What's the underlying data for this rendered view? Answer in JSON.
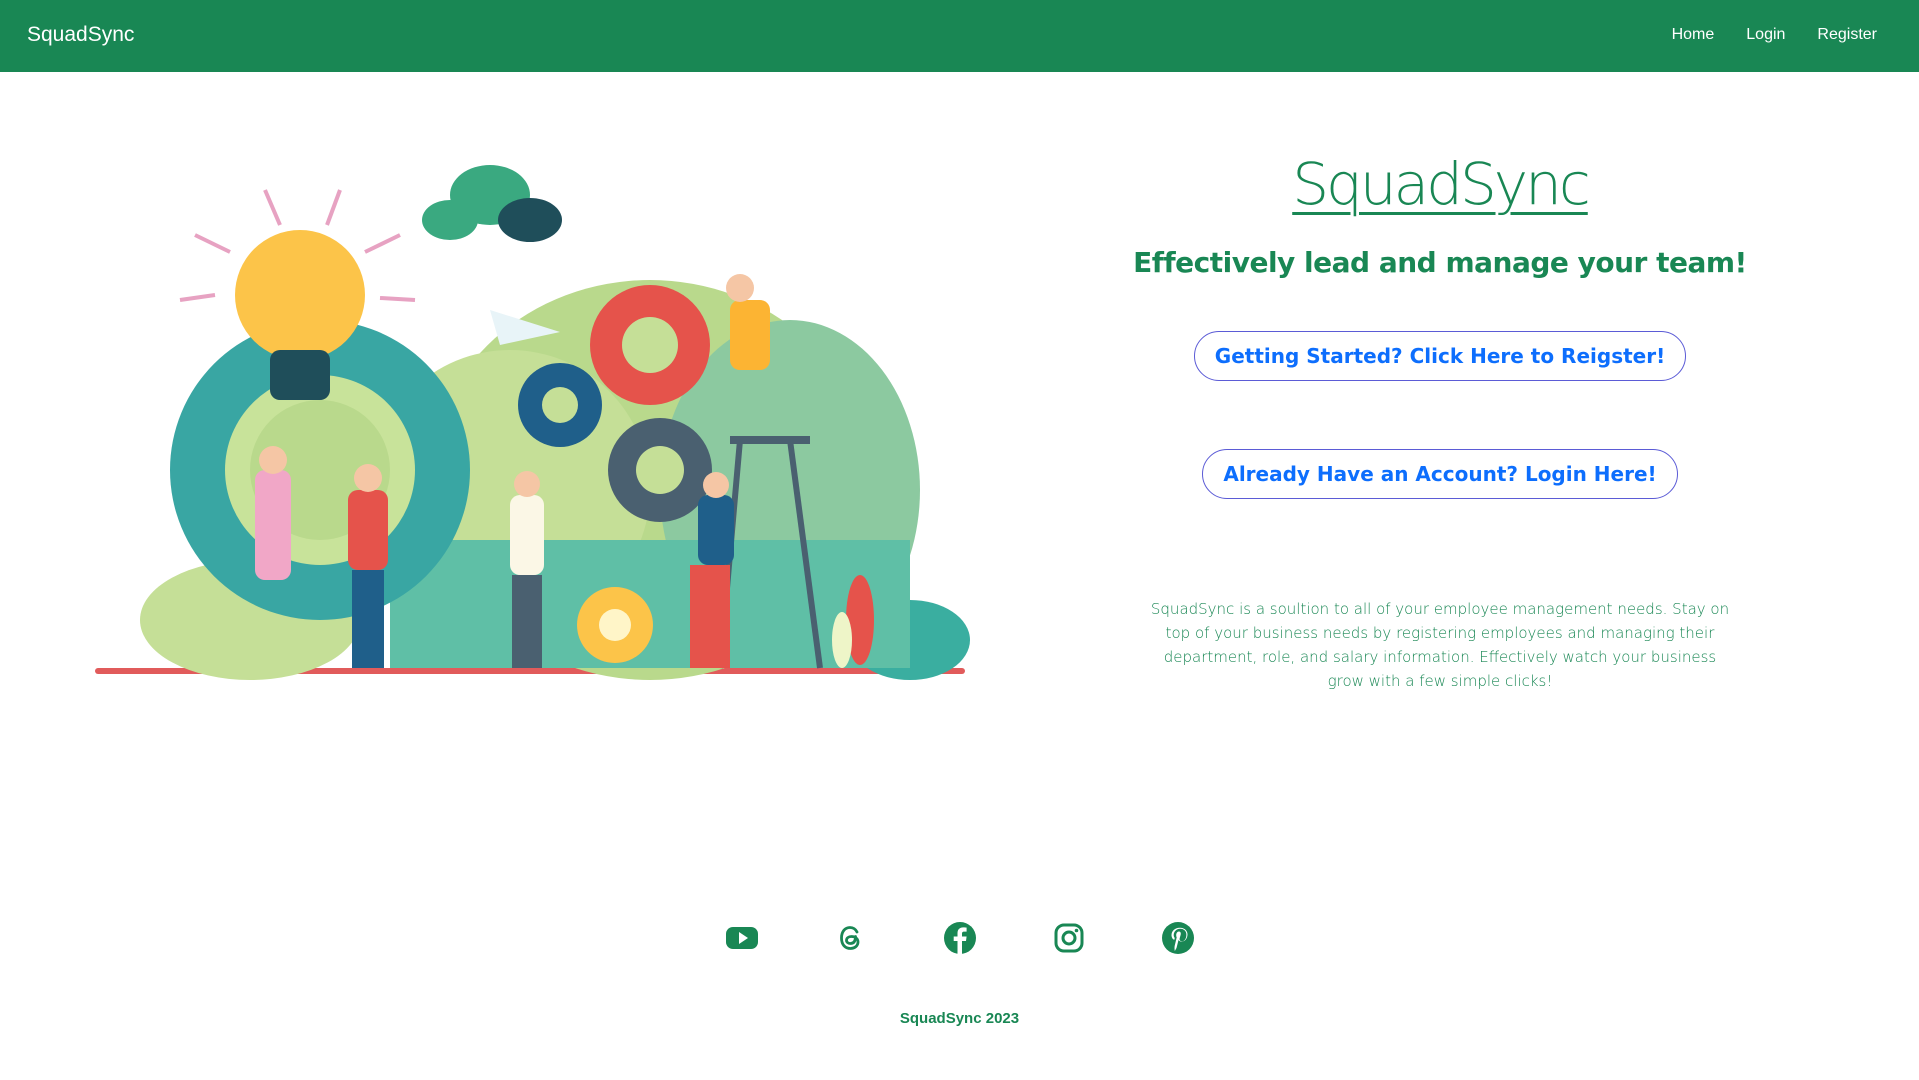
{
  "nav": {
    "brand": "SquadSync",
    "links": [
      "Home",
      "Login",
      "Register"
    ]
  },
  "hero": {
    "logo": "SquadSync",
    "tagline": "Effectively lead and manage your team!",
    "register_cta": "Getting Started? Click Here to Reigster!",
    "login_cta": "Already Have an Account? Login Here!",
    "description": "SquadSync is a soultion to all of your employee management needs. Stay on top of your business needs by registering employees and managing their department, role, and salary information. Effectively watch your business grow with a few simple clicks!"
  },
  "footer": {
    "social": [
      "youtube-icon",
      "threads-icon",
      "facebook-icon",
      "instagram-icon",
      "pinterest-icon"
    ],
    "copyright": "SquadSync 2023"
  },
  "colors": {
    "primary": "#198754",
    "link": "#0d6efd",
    "button_border": "#5b5bd6"
  }
}
